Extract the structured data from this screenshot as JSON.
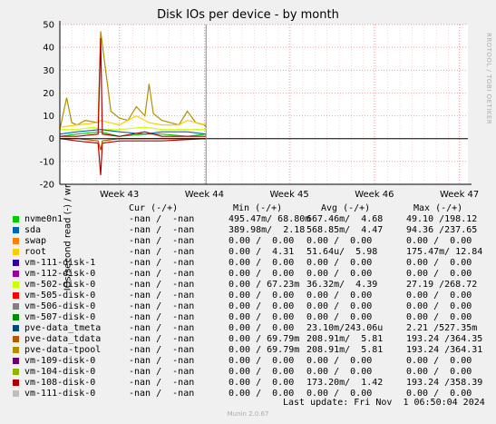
{
  "chart": {
    "title": "Disk IOs per device - by month",
    "ylabel": "IOs/second read (-) / write (+)",
    "side_label": "RRDTOOL / TOBI OETIKER",
    "footer": "Munin 2.0.67",
    "last_update": "Last update: Fri Nov  1 06:50:04 2024"
  },
  "legend_headers": {
    "cur": "Cur (-/+)",
    "min": "Min (-/+)",
    "avg": "Avg (-/+)",
    "max": "Max (-/+)"
  },
  "legend": [
    {
      "name": "nvme0n1",
      "color": "#00cc00",
      "cur": "-nan /  -nan",
      "min": "495.47m/ 68.80m",
      "avg": "667.46m/  4.68",
      "max": "49.10 /198.12"
    },
    {
      "name": "sda",
      "color": "#0066b3",
      "cur": "-nan /  -nan",
      "min": "389.98m/  2.18",
      "avg": "568.85m/  4.47",
      "max": "94.36 /237.65"
    },
    {
      "name": "swap",
      "color": "#ff8000",
      "cur": "-nan /  -nan",
      "min": "0.00 /  0.00",
      "avg": "0.00 /  0.00",
      "max": "0.00 /  0.00"
    },
    {
      "name": "root",
      "color": "#ffcc00",
      "cur": "-nan /  -nan",
      "min": "0.00 /  4.31",
      "avg": "51.64u/  5.98",
      "max": "175.47m/ 12.84"
    },
    {
      "name": "vm-111-disk-1",
      "color": "#330099",
      "cur": "-nan /  -nan",
      "min": "0.00 /  0.00",
      "avg": "0.00 /  0.00",
      "max": "0.00 /  0.00"
    },
    {
      "name": "vm-112-disk-0",
      "color": "#990099",
      "cur": "-nan /  -nan",
      "min": "0.00 /  0.00",
      "avg": "0.00 /  0.00",
      "max": "0.00 /  0.00"
    },
    {
      "name": "vm-502-disk-0",
      "color": "#ccff00",
      "cur": "-nan /  -nan",
      "min": "0.00 / 67.23m",
      "avg": "36.32m/  4.39",
      "max": "27.19 /268.72"
    },
    {
      "name": "vm-505-disk-0",
      "color": "#ff0000",
      "cur": "-nan /  -nan",
      "min": "0.00 /  0.00",
      "avg": "0.00 /  0.00",
      "max": "0.00 /  0.00"
    },
    {
      "name": "vm-506-disk-0",
      "color": "#808080",
      "cur": "-nan /  -nan",
      "min": "0.00 /  0.00",
      "avg": "0.00 /  0.00",
      "max": "0.00 /  0.00"
    },
    {
      "name": "vm-507-disk-0",
      "color": "#008f00",
      "cur": "-nan /  -nan",
      "min": "0.00 /  0.00",
      "avg": "0.00 /  0.00",
      "max": "0.00 /  0.00"
    },
    {
      "name": "pve-data_tmeta",
      "color": "#00487d",
      "cur": "-nan /  -nan",
      "min": "0.00 /  0.00",
      "avg": "23.10m/243.06u",
      "max": "2.21 /527.35m"
    },
    {
      "name": "pve-data_tdata",
      "color": "#b35a00",
      "cur": "-nan /  -nan",
      "min": "0.00 / 69.79m",
      "avg": "208.91m/  5.81",
      "max": "193.24 /364.35"
    },
    {
      "name": "pve-data-tpool",
      "color": "#b38f00",
      "cur": "-nan /  -nan",
      "min": "0.00 / 69.79m",
      "avg": "208.91m/  5.81",
      "max": "193.24 /364.31"
    },
    {
      "name": "vm-109-disk-0",
      "color": "#6b006b",
      "cur": "-nan /  -nan",
      "min": "0.00 /  0.00",
      "avg": "0.00 /  0.00",
      "max": "0.00 /  0.00"
    },
    {
      "name": "vm-104-disk-0",
      "color": "#8fb300",
      "cur": "-nan /  -nan",
      "min": "0.00 /  0.00",
      "avg": "0.00 /  0.00",
      "max": "0.00 /  0.00"
    },
    {
      "name": "vm-108-disk-0",
      "color": "#b30000",
      "cur": "-nan /  -nan",
      "min": "0.00 /  0.00",
      "avg": "173.20m/  1.42",
      "max": "193.24 /358.39"
    },
    {
      "name": "vm-111-disk-0",
      "color": "#bebebe",
      "cur": "-nan /  -nan",
      "min": "0.00 /  0.00",
      "avg": "0.00 /  0.00",
      "max": "0.00 /  0.00"
    }
  ],
  "chart_data": {
    "type": "line",
    "title": "Disk IOs per device - by month",
    "ylabel": "IOs/second read (-) / write (+)",
    "ylim": [
      -20,
      50
    ],
    "yticks": [
      -20,
      -10,
      0,
      10,
      20,
      30,
      40,
      50
    ],
    "x_ticks": [
      "Week 43",
      "Week 44",
      "Week 45",
      "Week 46",
      "Week 47"
    ],
    "x_tick_positions": [
      0.5,
      1.5,
      2.5,
      3.5,
      4.5
    ],
    "xlim": [
      -0.2,
      4.6
    ],
    "data_end": 1.52,
    "grid": true,
    "series": [
      {
        "name": "pve-data-tpool",
        "color": "#b38f00",
        "x": [
          -0.2,
          -0.12,
          -0.06,
          0,
          0.1,
          0.25,
          0.28,
          0.4,
          0.5,
          0.6,
          0.7,
          0.8,
          0.85,
          0.9,
          1.0,
          1.1,
          1.2,
          1.3,
          1.4,
          1.5,
          1.52
        ],
        "y": [
          4,
          18,
          7,
          6,
          8,
          7,
          47,
          12,
          9,
          8,
          14,
          10,
          24,
          11,
          8,
          7,
          6,
          12,
          7,
          6,
          5
        ]
      },
      {
        "name": "root",
        "color": "#ffcc00",
        "x": [
          -0.2,
          0,
          0.25,
          0.28,
          0.5,
          0.7,
          0.85,
          1.0,
          1.2,
          1.3,
          1.52
        ],
        "y": [
          5,
          6,
          7,
          8,
          6,
          10,
          7,
          6,
          6,
          8,
          6
        ]
      },
      {
        "name": "vm-502-disk-0",
        "color": "#ccff00",
        "x": [
          -0.2,
          0,
          0.2,
          0.28,
          0.5,
          0.8,
          1.0,
          1.3,
          1.52
        ],
        "y": [
          4,
          4,
          5,
          4,
          4,
          5,
          4,
          4,
          4
        ]
      },
      {
        "name": "nvme0n1",
        "color": "#00cc00",
        "x": [
          -0.2,
          0,
          0.28,
          0.5,
          0.8,
          1.0,
          1.3,
          1.52
        ],
        "y": [
          1,
          2,
          3,
          1,
          2,
          2,
          1,
          2
        ]
      },
      {
        "name": "sda",
        "color": "#0066b3",
        "x": [
          -0.2,
          0,
          0.28,
          0.5,
          0.8,
          1.0,
          1.3,
          1.52
        ],
        "y": [
          2,
          3,
          4,
          3,
          2,
          3,
          3,
          2
        ]
      },
      {
        "name": "vm-108-disk-0",
        "color": "#b30000",
        "x": [
          -0.2,
          0,
          0.25,
          0.28,
          0.3,
          0.5,
          0.8,
          1.0,
          1.52
        ],
        "y": [
          1,
          1,
          2,
          44,
          2,
          1,
          3,
          1,
          1
        ]
      },
      {
        "name": "vm-108-disk-0",
        "color": "#b30000",
        "x": [
          -0.2,
          0,
          0.25,
          0.28,
          0.3,
          0.5,
          0.8,
          1.0,
          1.52
        ],
        "y": [
          0,
          -1,
          -2,
          -16,
          -2,
          -1,
          -1,
          -1,
          0
        ]
      },
      {
        "name": "pve-data_tdata",
        "color": "#b35a00",
        "x": [
          -0.2,
          0,
          0.25,
          0.28,
          0.3,
          0.5,
          1.52
        ],
        "y": [
          0,
          0,
          -1,
          -5,
          -1,
          0,
          0
        ]
      }
    ]
  }
}
